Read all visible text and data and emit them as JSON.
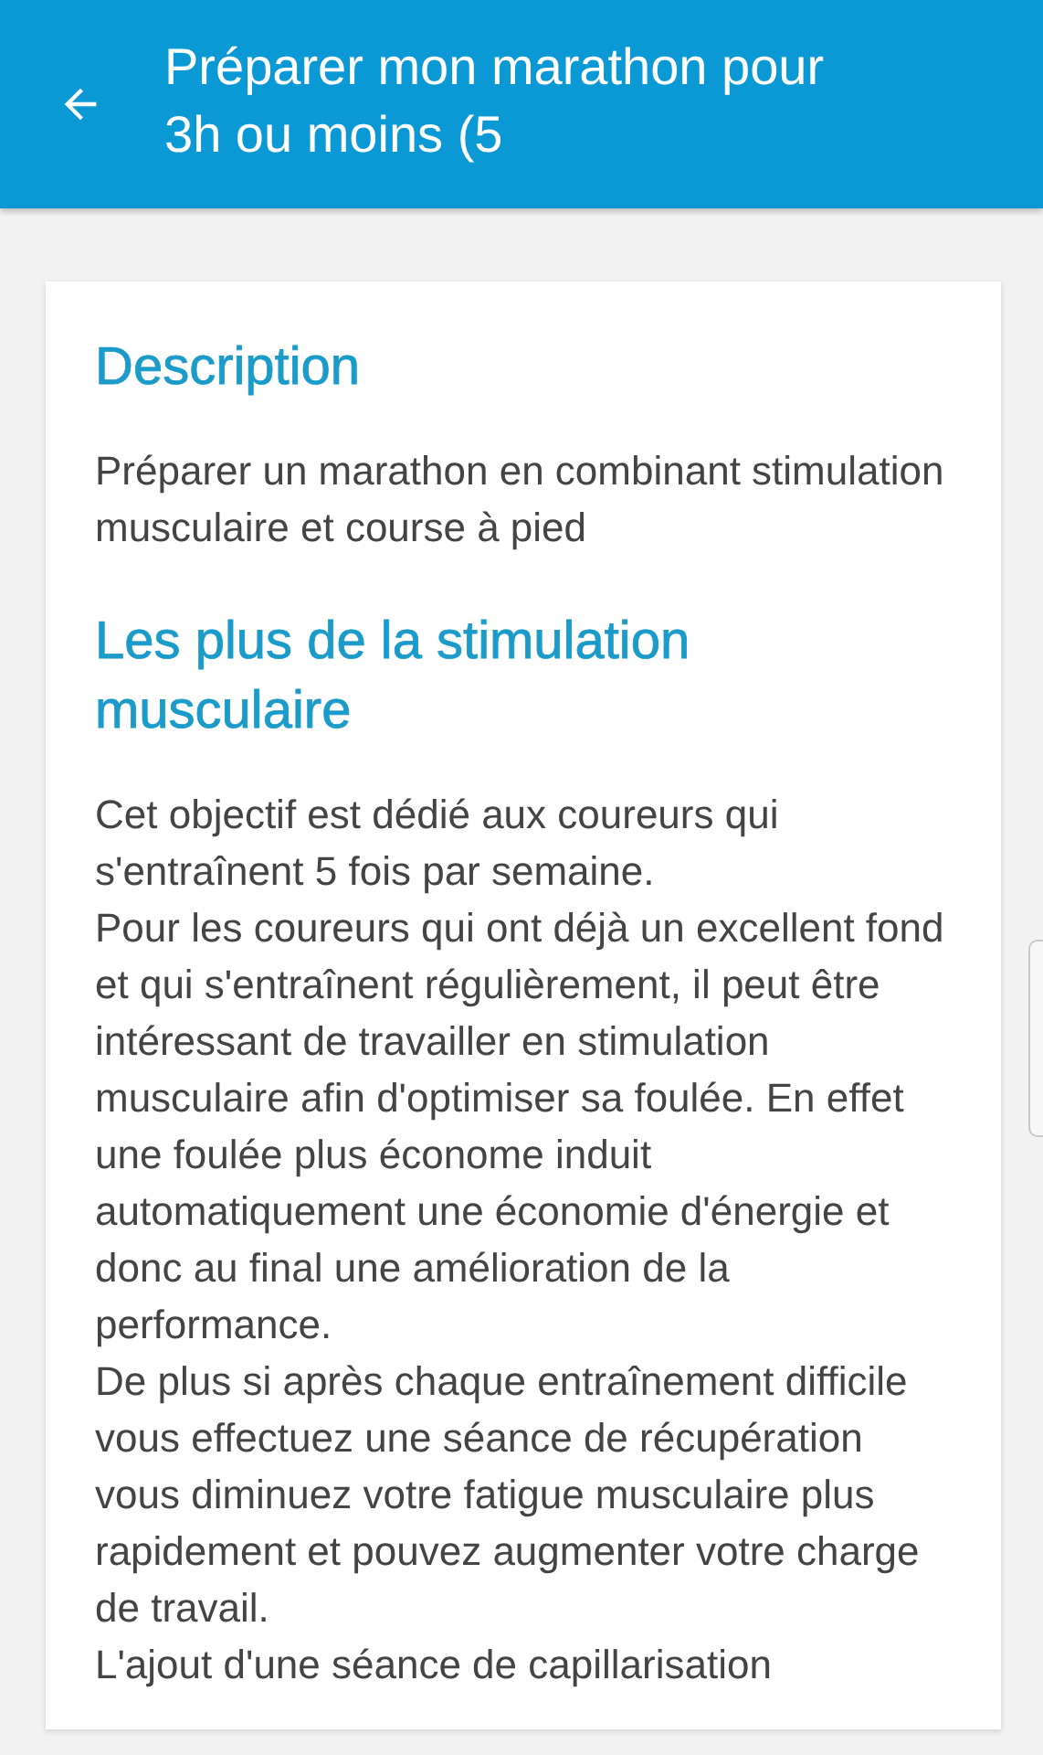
{
  "app_bar": {
    "title": "Préparer mon marathon pour 3h ou moins (5"
  },
  "sections": [
    {
      "heading": "Description",
      "paragraphs": [
        "Préparer un marathon en combinant stimulation musculaire et course à pied"
      ]
    },
    {
      "heading": "Les plus de la stimulation musculaire",
      "paragraphs": [
        "Cet objectif est dédié aux coureurs qui s'entraînent 5 fois par semaine.",
        "Pour les coureurs qui ont déjà un excellent fond et qui s'entraînent régulièrement, il peut être intéressant de travailler en stimulation musculaire afin d'optimiser sa foulée. En effet une foulée plus économe induit automatiquement une économie d'énergie et donc au final une amélioration de la performance.",
        "De plus si après chaque entraînement difficile vous effectuez une séance de récupération vous diminuez votre fatigue musculaire plus rapidement et pouvez augmenter votre charge de travail.",
        "L'ajout d'une séance de capillarisation"
      ]
    }
  ]
}
